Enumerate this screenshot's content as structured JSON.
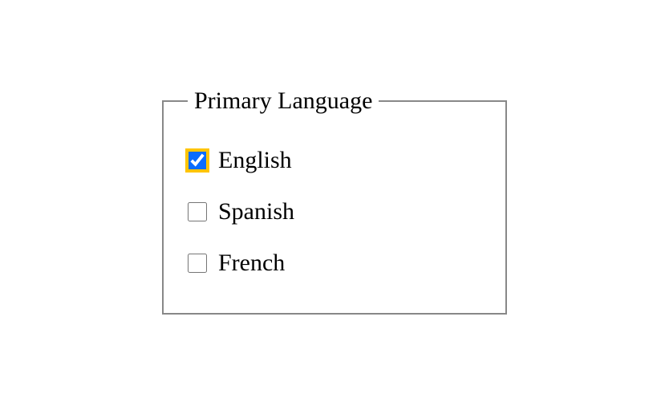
{
  "fieldset": {
    "legend": "Primary Language",
    "options": [
      {
        "label": "English",
        "checked": true,
        "highlighted": true
      },
      {
        "label": "Spanish",
        "checked": false,
        "highlighted": false
      },
      {
        "label": "French",
        "checked": false,
        "highlighted": false
      }
    ]
  }
}
